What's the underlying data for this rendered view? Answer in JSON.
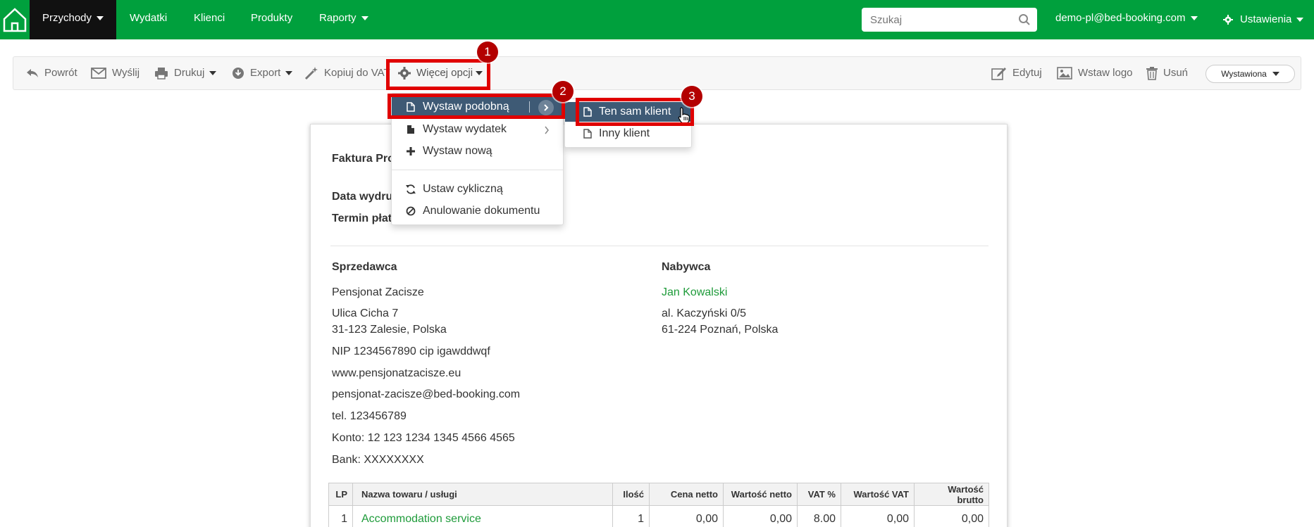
{
  "nav": {
    "items": [
      {
        "label": "Przychody",
        "caret": true,
        "active": true
      },
      {
        "label": "Wydatki"
      },
      {
        "label": "Klienci"
      },
      {
        "label": "Produkty"
      },
      {
        "label": "Raporty",
        "caret": true
      }
    ],
    "search_placeholder": "Szukaj",
    "user": "demo-pl@bed-booking.com",
    "settings": "Ustawienia"
  },
  "toolbar": {
    "back": "Powrót",
    "send": "Wyślij",
    "print": "Drukuj",
    "export": "Export",
    "copy_vat": "Kopiuj do VAT",
    "more": "Więcej opcji",
    "edit": "Edytuj",
    "insert_logo": "Wstaw logo",
    "delete": "Usuń",
    "status": "Wystawiona"
  },
  "more_menu": {
    "items": [
      {
        "label": "Wystaw podobną",
        "icon": "file-icon"
      },
      {
        "label": "Wystaw wydatek",
        "icon": "file-solid-icon"
      },
      {
        "label": "Wystaw nową",
        "icon": "plus-icon"
      },
      {
        "label": "Ustaw cykliczną",
        "icon": "refresh-icon"
      },
      {
        "label": "Anulowanie dokumentu",
        "icon": "ban-icon"
      }
    ]
  },
  "submenu": {
    "items": [
      {
        "label": "Ten sam klient"
      },
      {
        "label": "Inny klient"
      }
    ]
  },
  "annotations": [
    "1",
    "2",
    "3"
  ],
  "document": {
    "title_partial": "Faktura Pro",
    "issue_date_partial": "Data wydru",
    "due_date_partial": "Termin płat",
    "seller": {
      "heading": "Sprzedawca",
      "name": "Pensjonat Zacisze",
      "street": "Ulica Cicha 7",
      "city": "31-123 Zalesie, Polska",
      "nip": "NIP 1234567890 cip igawddwqf",
      "www": "www.pensjonatzacisze.eu",
      "email": "pensjonat-zacisze@bed-booking.com",
      "phone": "tel. 123456789",
      "account": "Konto: 12 123 1234 1345 4566 4565",
      "bank": "Bank: XXXXXXXX"
    },
    "buyer": {
      "heading": "Nabywca",
      "name": "Jan Kowalski",
      "street": "al. Kaczyński 0/5",
      "city": "61-224 Poznań, Polska"
    },
    "table": {
      "headers": [
        "LP",
        "Nazwa towaru / usługi",
        "Ilość",
        "Cena netto",
        "Wartość netto",
        "VAT %",
        "Wartość VAT",
        "Wartość brutto"
      ],
      "rows": [
        [
          "1",
          "Accommodation service",
          "1",
          "0,00",
          "0,00",
          "8.00",
          "0,00",
          "0,00"
        ]
      ]
    }
  },
  "colors": {
    "brand_green": "#00a03d",
    "link_green": "#1e9b3a",
    "menu_highlight": "#3e5a75",
    "annotation_red": "#e00000"
  }
}
